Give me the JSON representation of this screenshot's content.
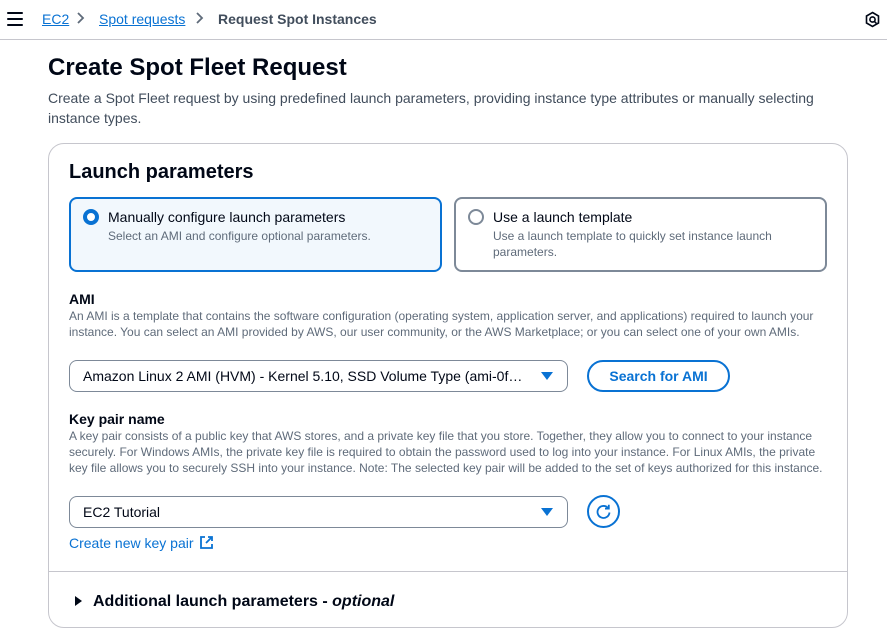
{
  "breadcrumb": {
    "items": [
      {
        "label": "EC2"
      },
      {
        "label": "Spot requests"
      },
      {
        "label": "Request Spot Instances"
      }
    ]
  },
  "icons": {
    "menu": "hamburger-menu-icon",
    "help": "help-panel-icon",
    "refresh": "refresh-icon",
    "external": "external-link-icon"
  },
  "colors": {
    "accent": "#0972d3",
    "text": "#000716",
    "secondary_text": "#5f6b7a",
    "selected_tile_bg": "#f2f8fd"
  },
  "page": {
    "title": "Create Spot Fleet Request",
    "description": "Create a Spot Fleet request by using predefined launch parameters, providing instance type attributes or manually selecting instance types."
  },
  "launch_parameters": {
    "title": "Launch parameters",
    "options": [
      {
        "label": "Manually configure launch parameters",
        "description": "Select an AMI and configure optional parameters.",
        "selected": true
      },
      {
        "label": "Use a launch template",
        "description": "Use a launch template to quickly set instance launch parameters.",
        "selected": false
      }
    ]
  },
  "ami": {
    "label": "AMI",
    "description": "An AMI is a template that contains the software configuration (operating system, application server, and applications) required to launch your instance. You can select an AMI provided by AWS, our user community, or the AWS Marketplace; or you can select one of your own AMIs.",
    "selected_value": "Amazon Linux 2 AMI (HVM) - Kernel 5.10, SSD Volume Type (ami-0f…",
    "search_button": "Search for AMI"
  },
  "key_pair": {
    "label": "Key pair name",
    "description": "A key pair consists of a public key that AWS stores, and a private key file that you store. Together, they allow you to connect to your instance securely. For Windows AMIs, the private key file is required to obtain the password used to log into your instance. For Linux AMIs, the private key file allows you to securely SSH into your instance. Note: The selected key pair will be added to the set of keys authorized for this instance.",
    "selected_value": "EC2 Tutorial",
    "create_link": "Create new key pair"
  },
  "additional": {
    "label": "Additional launch parameters - ",
    "optional": "optional"
  }
}
